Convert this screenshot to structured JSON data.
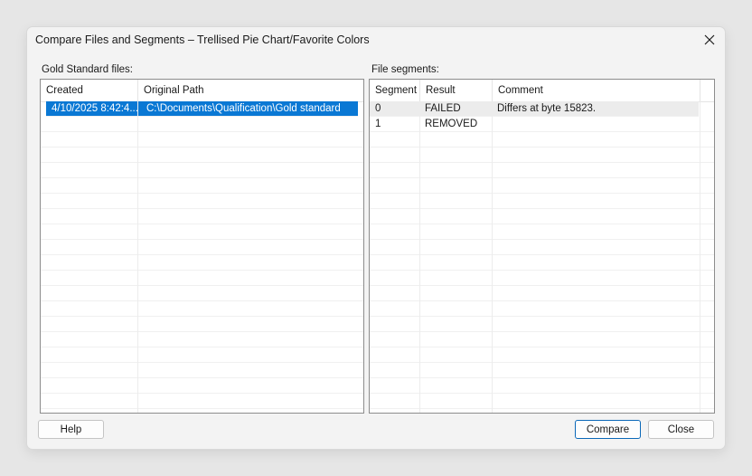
{
  "window": {
    "title": "Compare Files and Segments – Trellised Pie Chart/Favorite Colors"
  },
  "gold": {
    "label": "Gold Standard files:",
    "columns": [
      "Created",
      "Original Path"
    ],
    "rows": [
      {
        "created": "4/10/2025 8:42:4...",
        "path": "C:\\Documents\\Qualification\\Gold standard",
        "selected": true
      }
    ]
  },
  "segments": {
    "label": "File segments:",
    "columns": [
      "Segment",
      "Result",
      "Comment"
    ],
    "rows": [
      {
        "segment": "0",
        "result": "FAILED",
        "comment": "Differs at byte 15823."
      },
      {
        "segment": "1",
        "result": "REMOVED",
        "comment": ""
      }
    ]
  },
  "buttons": {
    "help": "Help",
    "compare": "Compare",
    "close": "Close"
  },
  "colors": {
    "selection": "#0a78d4",
    "default_button_border": "#0a68b8"
  }
}
